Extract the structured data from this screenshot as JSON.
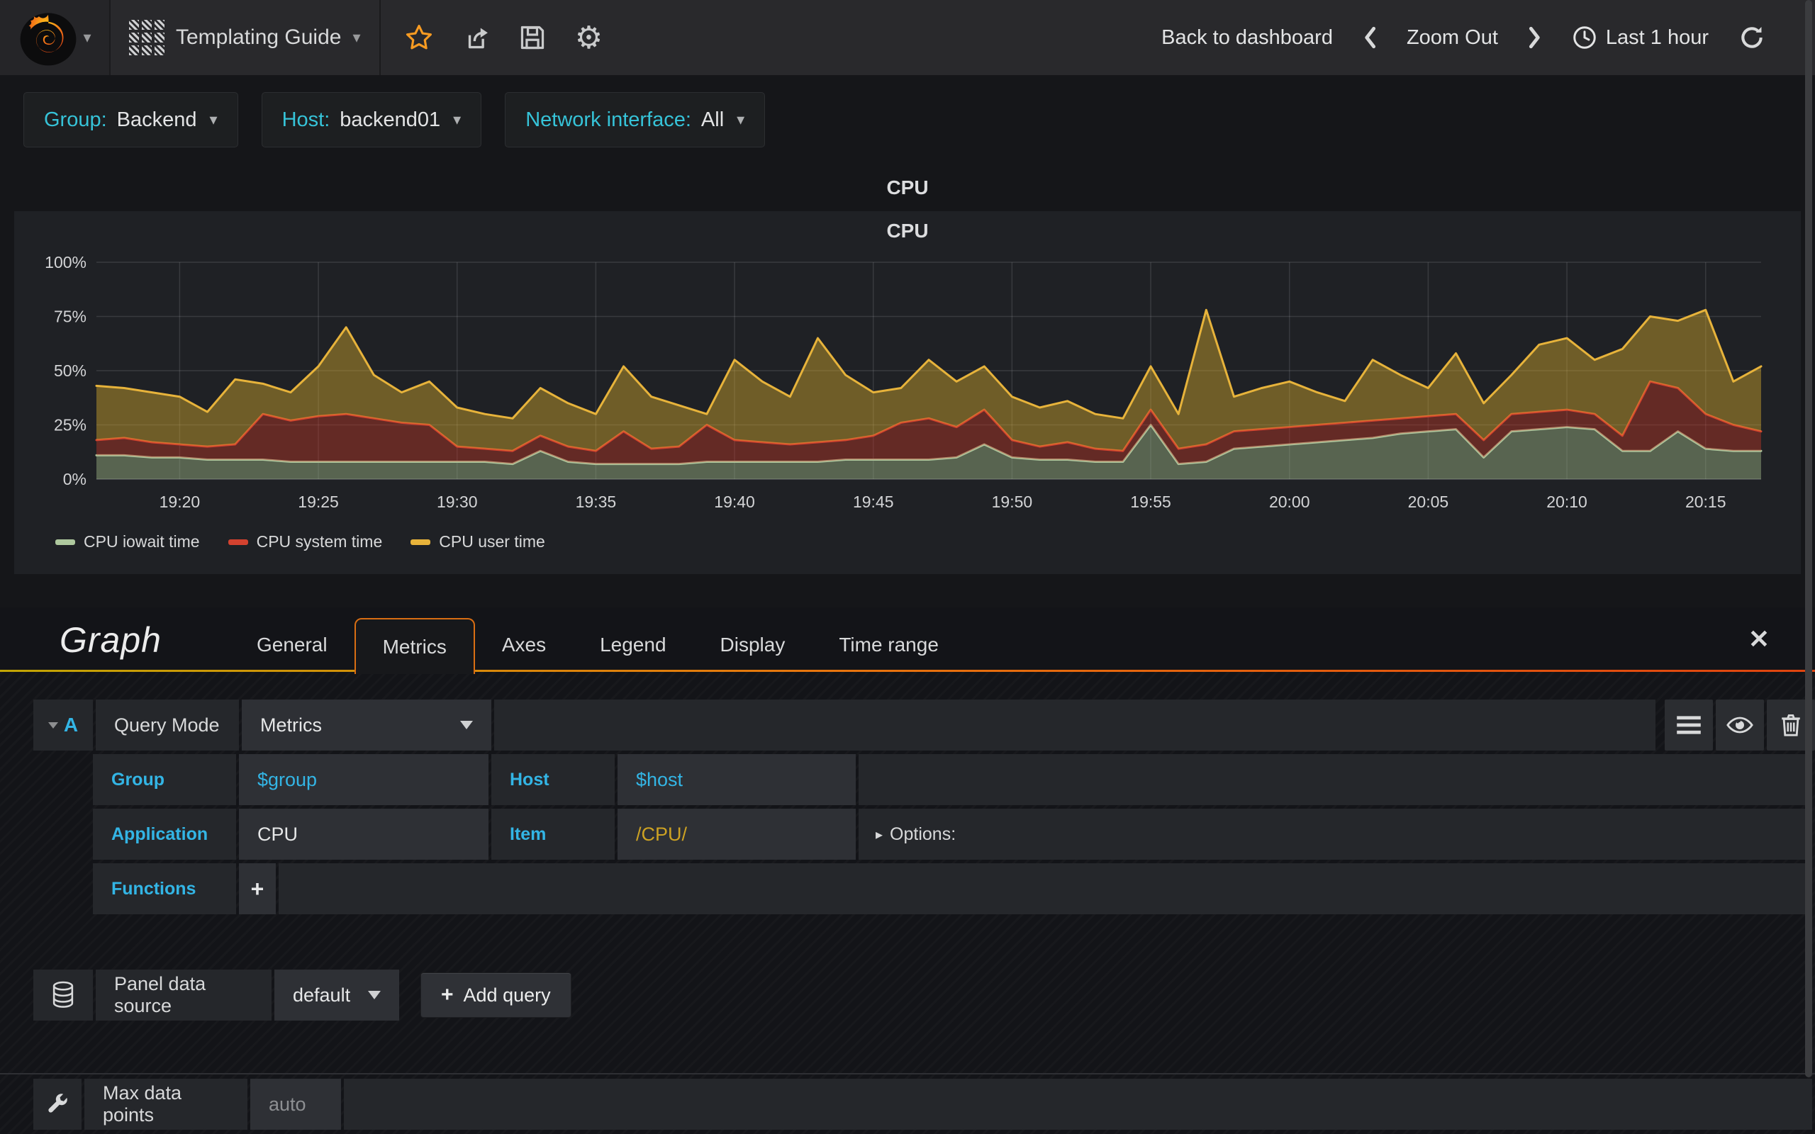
{
  "navbar": {
    "dashboard_title": "Templating Guide",
    "back_to_dashboard": "Back to dashboard",
    "zoom_out": "Zoom Out",
    "time_range": "Last 1 hour"
  },
  "variables": [
    {
      "label": "Group:",
      "value": "Backend"
    },
    {
      "label": "Host:",
      "value": "backend01"
    },
    {
      "label": "Network interface:",
      "value": "All"
    }
  ],
  "row_title": "CPU",
  "panel": {
    "title": "CPU"
  },
  "chart_data": {
    "type": "area",
    "stacked": true,
    "title": "CPU",
    "ylabel": "",
    "ylim": [
      0,
      100
    ],
    "grid": true,
    "legend_position": "bottom-left",
    "x_start": "19:17",
    "x_total_minutes": 60,
    "x_ticks": [
      {
        "t": 3,
        "label": "19:20"
      },
      {
        "t": 8,
        "label": "19:25"
      },
      {
        "t": 13,
        "label": "19:30"
      },
      {
        "t": 18,
        "label": "19:35"
      },
      {
        "t": 23,
        "label": "19:40"
      },
      {
        "t": 28,
        "label": "19:45"
      },
      {
        "t": 33,
        "label": "19:50"
      },
      {
        "t": 38,
        "label": "19:55"
      },
      {
        "t": 43,
        "label": "20:00"
      },
      {
        "t": 48,
        "label": "20:05"
      },
      {
        "t": 53,
        "label": "20:10"
      },
      {
        "t": 58,
        "label": "20:15"
      }
    ],
    "y_ticks": [
      {
        "v": 0,
        "label": "0%"
      },
      {
        "v": 25,
        "label": "25%"
      },
      {
        "v": 50,
        "label": "50%"
      },
      {
        "v": 75,
        "label": "75%"
      },
      {
        "v": 100,
        "label": "100%"
      }
    ],
    "interval_minutes": 1,
    "series": [
      {
        "name": "CPU iowait time",
        "color": "#AEC89E",
        "fill": "rgba(158,182,134,0.45)",
        "values": [
          11,
          11,
          10,
          10,
          9,
          9,
          9,
          8,
          8,
          8,
          8,
          8,
          8,
          8,
          8,
          7,
          13,
          8,
          7,
          7,
          7,
          7,
          8,
          8,
          8,
          8,
          8,
          9,
          9,
          9,
          9,
          10,
          16,
          10,
          9,
          9,
          8,
          8,
          25,
          7,
          8,
          14,
          15,
          16,
          17,
          18,
          19,
          21,
          22,
          23,
          10,
          22,
          23,
          24,
          23,
          13,
          13,
          22,
          14,
          13,
          13
        ]
      },
      {
        "name": "CPU system time",
        "color": "#D3422F",
        "fill": "rgba(196,54,38,0.42)",
        "values": [
          7,
          8,
          7,
          6,
          6,
          7,
          21,
          19,
          21,
          22,
          20,
          18,
          17,
          7,
          6,
          6,
          7,
          7,
          6,
          15,
          7,
          8,
          17,
          10,
          9,
          8,
          9,
          9,
          11,
          17,
          19,
          14,
          16,
          8,
          6,
          8,
          6,
          5,
          7,
          7,
          8,
          8,
          8,
          8,
          8,
          8,
          8,
          7,
          7,
          7,
          8,
          8,
          8,
          8,
          7,
          7,
          32,
          20,
          16,
          12,
          9
        ]
      },
      {
        "name": "CPU user time",
        "color": "#E7B33B",
        "fill": "rgba(222,176,46,0.42)",
        "values": [
          25,
          23,
          23,
          22,
          16,
          30,
          14,
          13,
          23,
          40,
          20,
          14,
          20,
          18,
          16,
          15,
          22,
          20,
          17,
          30,
          24,
          19,
          5,
          37,
          28,
          22,
          48,
          30,
          20,
          16,
          27,
          21,
          20,
          20,
          18,
          19,
          16,
          15,
          20,
          16,
          62,
          16,
          19,
          21,
          15,
          10,
          28,
          20,
          13,
          28,
          17,
          18,
          31,
          33,
          25,
          40,
          30,
          31,
          48,
          20,
          30
        ]
      }
    ]
  },
  "editor": {
    "section_title": "Graph",
    "tabs": [
      {
        "label": "General"
      },
      {
        "label": "Metrics"
      },
      {
        "label": "Axes"
      },
      {
        "label": "Legend"
      },
      {
        "label": "Display"
      },
      {
        "label": "Time range"
      }
    ],
    "close_glyph": "✕",
    "query": {
      "letter": "A",
      "mode_label": "Query Mode",
      "mode_value": "Metrics",
      "group_label": "Group",
      "group_value": "$group",
      "host_label": "Host",
      "host_value": "$host",
      "app_label": "Application",
      "app_value": "CPU",
      "item_label": "Item",
      "item_value": "/CPU/",
      "options_label": "Options:",
      "functions_label": "Functions",
      "add_function_glyph": "+"
    },
    "datasource": {
      "label": "Panel data source",
      "value": "default",
      "add_query_label": "Add query",
      "add_query_plus": "+"
    },
    "settings": {
      "max_data_points_label": "Max data points",
      "max_data_points_value": "auto"
    }
  },
  "colors": {
    "accent_blue": "#33b5e5",
    "variable_label": "#36c3d8",
    "tab_active_border": "#d96e13",
    "star_orange": "#f79b22",
    "item_regex_gold": "#cda223"
  }
}
